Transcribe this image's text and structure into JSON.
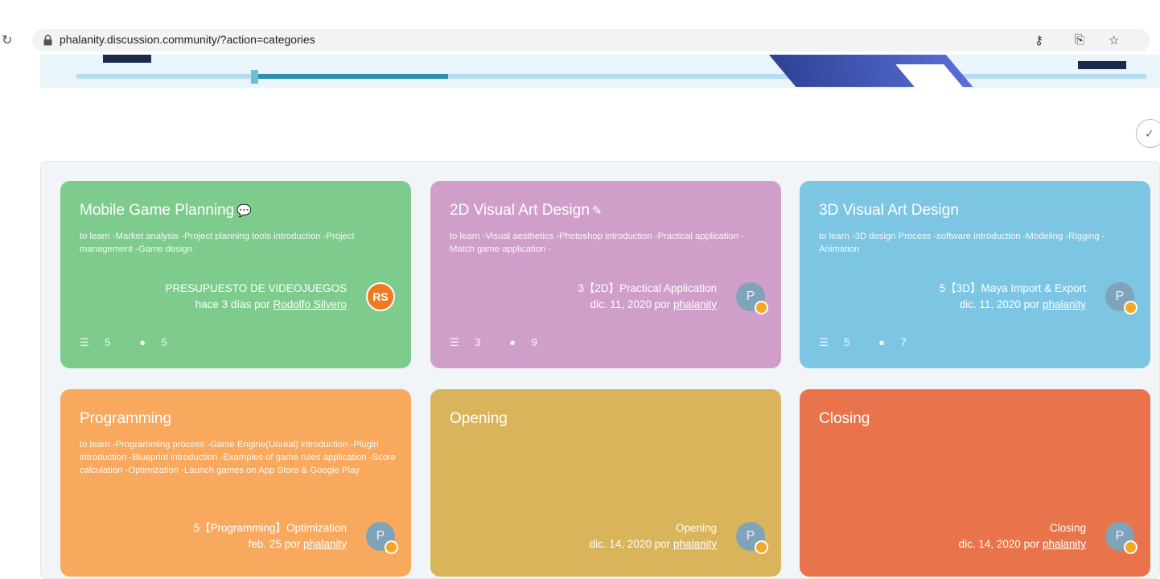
{
  "browser": {
    "url": "phalanity.discussion.community/?action=categories"
  },
  "categories": [
    {
      "title": "Mobile Game Planning",
      "title_icon": "💬",
      "description": "to learn -Market analysis -Project planning tools introduction -Project management -Game design",
      "last_topic": "PRESUPUESTO DE VIDEOJUEGOS",
      "last_time": "hace 3 días por",
      "last_author": "Rodolfo Silvero",
      "avatar": "RS",
      "topics": "5",
      "posts": "5"
    },
    {
      "title": "2D Visual Art Design",
      "title_icon": "✎",
      "description": "to learn -Visual aesthetics -Photoshop introduction -Practical application -Match game application -",
      "last_topic": "3【2D】Practical Application",
      "last_time": "dic. 11, 2020 por",
      "last_author": "phalanity",
      "avatar": "P",
      "topics": "3",
      "posts": "9"
    },
    {
      "title": "3D Visual Art Design",
      "title_icon": "",
      "description": "to learn -3D design Process -software introduction -Modeling -Rigging -Animation",
      "last_topic": "5【3D】Maya Import & Export",
      "last_time": "dic. 11, 2020 por",
      "last_author": "phalanity",
      "avatar": "P",
      "topics": "5",
      "posts": "7"
    },
    {
      "title": "Programming",
      "title_icon": "",
      "description": "to learn -Programming process -Game Engine(Unreal) introduction -Plugin introduction -Blueprint introduction -Examples of game rules application -Score calculation -Optimization -Launch games on App Store & Google Play",
      "last_topic": "5【Programming】Optimization",
      "last_time": "feb. 25 por",
      "last_author": "phalanity",
      "avatar": "P"
    },
    {
      "title": "Opening",
      "title_icon": "",
      "description": "",
      "last_topic": "Opening",
      "last_time": "dic. 14, 2020 por",
      "last_author": "phalanity",
      "avatar": "P"
    },
    {
      "title": "Closing",
      "title_icon": "",
      "description": "",
      "last_topic": "Closing",
      "last_time": "dic. 14, 2020 por",
      "last_author": "phalanity",
      "avatar": "P"
    }
  ],
  "colors": {
    "green": "#7dcb8d",
    "pink": "#cf9fca",
    "blue": "#7cc6e4",
    "orange": "#f8a95e",
    "yellow": "#d9b45a",
    "red": "#e9744b"
  }
}
